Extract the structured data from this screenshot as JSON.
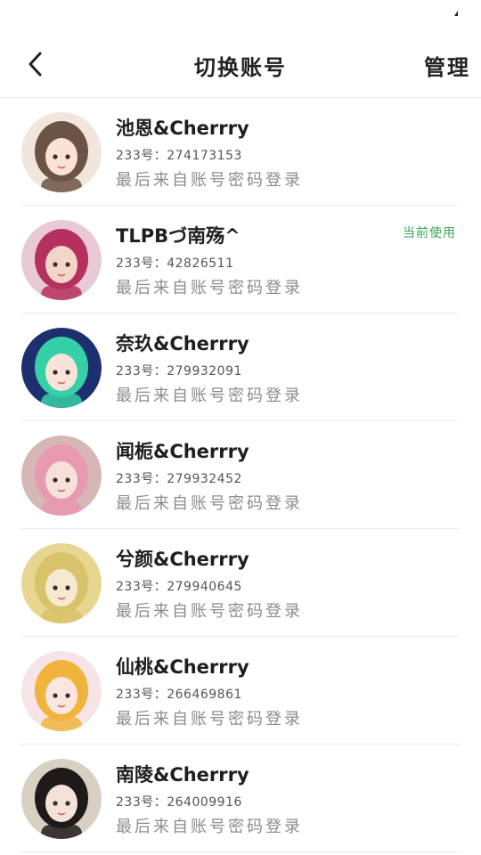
{
  "header": {
    "title": "切换账号",
    "manage_label": "管理"
  },
  "icons": {
    "back": "chevron-left-icon",
    "status": "signal-icon"
  },
  "accounts": [
    {
      "name": "池恩&Cherrry",
      "id_line": "233号：274173153",
      "hint": "最后来自账号密码登录",
      "badge": "",
      "colors": [
        "#f2e6dc",
        "#6b5446",
        "#fbe2d6"
      ]
    },
    {
      "name": "TLPBづ南殇^",
      "id_line": "233号：42826511",
      "hint": "最后来自账号密码登录",
      "badge": "当前使用",
      "colors": [
        "#e8c9d6",
        "#b5305f",
        "#f3d6c8"
      ]
    },
    {
      "name": "奈玖&Cherrry",
      "id_line": "233号：279932091",
      "hint": "最后来自账号密码登录",
      "badge": "",
      "colors": [
        "#1c2f6e",
        "#35d0a8",
        "#f7e3d7"
      ]
    },
    {
      "name": "闻栀&Cherrry",
      "id_line": "233号：279932452",
      "hint": "最后来自账号密码登录",
      "badge": "",
      "colors": [
        "#d7b7b5",
        "#e89ab0",
        "#f6e0da"
      ]
    },
    {
      "name": "兮颜&Cherrry",
      "id_line": "233号：279940645",
      "hint": "最后来自账号密码登录",
      "badge": "",
      "colors": [
        "#e6d68f",
        "#d8c26a",
        "#f5ead0"
      ]
    },
    {
      "name": "仙桃&Cherrry",
      "id_line": "233号：266469861",
      "hint": "最后来自账号密码登录",
      "badge": "",
      "colors": [
        "#f6e4e6",
        "#f0b43c",
        "#fbe5df"
      ]
    },
    {
      "name": "南陵&Cherrry",
      "id_line": "233号：264009916",
      "hint": "最后来自账号密码登录",
      "badge": "",
      "colors": [
        "#d9d0c4",
        "#1f1a1a",
        "#f4e2d8"
      ]
    }
  ]
}
